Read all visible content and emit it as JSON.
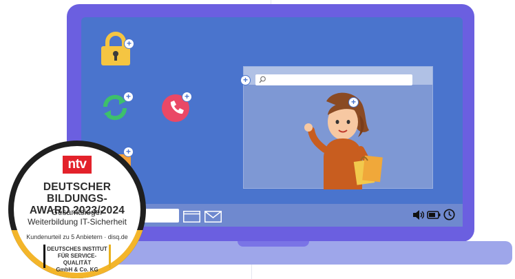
{
  "browser": {
    "search_placeholder": ""
  },
  "award": {
    "brand": "ntv",
    "title_line1": "DEUTSCHER BILDUNGS-",
    "title_line2": "AWARD 2023/2024",
    "subtitle_line1": "Gesamtsieger",
    "subtitle_line2": "Weiterbildung IT-Sicherheit",
    "note": "Kundenurteil zu 5 Anbietern · disq.de",
    "institute_line1": "DEUTSCHES INSTITUT",
    "institute_line2": "FÜR SERVICE-QUALITÄT",
    "institute_line3": "GmbH & Co. KG"
  },
  "icons": {
    "desktop": [
      "lock-icon",
      "sync-icon",
      "phone-icon",
      "folder-icon"
    ],
    "taskbar": [
      "window-icon",
      "mail-icon",
      "speaker-icon",
      "battery-icon",
      "clock-icon"
    ]
  },
  "colors": {
    "bezel": "#6b5fe0",
    "screen": "#4a74cd",
    "lock": "#f5c542",
    "sync": "#3dc06c",
    "phone": "#ea4866",
    "badge_red": "#e3222b",
    "badge_gold": "#f3b52a"
  }
}
